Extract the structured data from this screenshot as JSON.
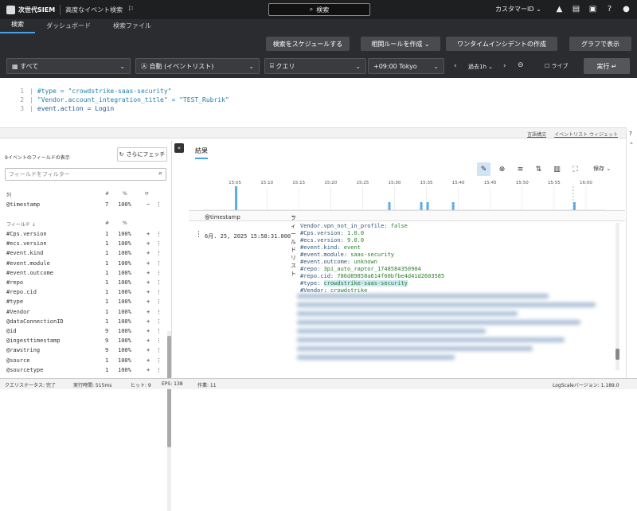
{
  "app": {
    "name": "次世代SIEM",
    "page_title": "高度なイベント検索"
  },
  "topbar": {
    "search_label": "検索",
    "customer_label": "カスタマーID"
  },
  "tabs": [
    {
      "label": "検索",
      "active": true
    },
    {
      "label": "ダッシュボード"
    },
    {
      "label": "検索ファイル"
    }
  ],
  "actions": {
    "schedule": "検索をスケジュールする",
    "related_rules": "相関ルールを作成",
    "onetime_incident": "ワンタイムインシデントの作成",
    "graph": "グラフで表示"
  },
  "query_bar": {
    "repo": "すべて",
    "mode": "自動 (イベントリスト)",
    "query": "クエリ",
    "timezone": "+09:00 Tokyo",
    "range": "過去1h",
    "live": "ライブ",
    "run": "実行"
  },
  "editor": {
    "lines": [
      {
        "num": "1",
        "op": "",
        "text": "#type = \"crowdstrike-saas-security\""
      },
      {
        "num": "2",
        "op": "| ",
        "text": "\"Vendor.account_integration_title\" = \"TEST_Rubrik\""
      },
      {
        "num": "3",
        "op": "| ",
        "text": "event.action = Login"
      }
    ]
  },
  "divider": {
    "syntax_link": "言語構文",
    "widget_link": "イベントリスト ウィジェット"
  },
  "fields_panel": {
    "title": "9イベントのフィールドの表示",
    "fetch_button": "さらにフェッチ",
    "filter_placeholder": "フィールドをフィルター",
    "column_header": {
      "name": "列",
      "count": "#",
      "pct": "%"
    },
    "columns": [
      {
        "name": "@timestamp",
        "count": "7",
        "pct": "100%"
      }
    ],
    "fields_header": {
      "name": "フィールド ↓",
      "count": "#",
      "pct": "%"
    },
    "fields": [
      {
        "name": "#Cps.version",
        "count": "1",
        "pct": "100%"
      },
      {
        "name": "#ecs.version",
        "count": "1",
        "pct": "100%"
      },
      {
        "name": "#event.kind",
        "count": "1",
        "pct": "100%"
      },
      {
        "name": "#event.module",
        "count": "1",
        "pct": "100%"
      },
      {
        "name": "#event.outcome",
        "count": "1",
        "pct": "100%"
      },
      {
        "name": "#repo",
        "count": "1",
        "pct": "100%"
      },
      {
        "name": "#repo.cid",
        "count": "1",
        "pct": "100%"
      },
      {
        "name": "#type",
        "count": "1",
        "pct": "100%"
      },
      {
        "name": "#Vendor",
        "count": "1",
        "pct": "100%"
      },
      {
        "name": "@dataConnectionID",
        "count": "1",
        "pct": "100%"
      },
      {
        "name": "@id",
        "count": "9",
        "pct": "100%"
      },
      {
        "name": "@ingesttimestamp",
        "count": "9",
        "pct": "100%"
      },
      {
        "name": "@rawstring",
        "count": "9",
        "pct": "100%"
      },
      {
        "name": "@source",
        "count": "1",
        "pct": "100%"
      },
      {
        "name": "@sourcetype",
        "count": "1",
        "pct": "100%"
      }
    ]
  },
  "results": {
    "tab": "結果",
    "hold": "保存",
    "col_timestamp": "@timestamp",
    "col_fields": "フィールドリスト",
    "timestamp": "6月. 25, 2025 15:58:31.000",
    "lines": [
      {
        "k": "Vendor.vpn_not_in_profile: ",
        "v": "false"
      },
      {
        "k": "#Cps.version: ",
        "v": "1.0.0"
      },
      {
        "k": "#ecs.version: ",
        "v": "9.0.0"
      },
      {
        "k": "#event.kind: ",
        "v": "event"
      },
      {
        "k": "#event.module: ",
        "v": "saas-security"
      },
      {
        "k": "#event.outcome: ",
        "v": "unknown"
      },
      {
        "k": "#repo: ",
        "v": "3pi_auto_raptor_1748584350904"
      },
      {
        "k": "#repo.cid: ",
        "v": "786d89858a614f60bfbe4d41d2603585"
      },
      {
        "k": "#type: ",
        "v": "crowdstrike-saas-security",
        "hl": true
      },
      {
        "k": "#Vendor: ",
        "v": "crowdstrike"
      }
    ]
  },
  "chart_data": {
    "type": "bar",
    "x_ticks": [
      "15:05",
      "15:10",
      "15:15",
      "15:20",
      "15:25",
      "15:30",
      "15:35",
      "15:40",
      "15:45",
      "15:50",
      "15:55",
      "16:00"
    ],
    "y_max_label": "3",
    "bars": [
      {
        "t": "15:05",
        "value": 3
      },
      {
        "t": "15:29",
        "value": 1
      },
      {
        "t": "15:34",
        "value": 1
      },
      {
        "t": "15:35",
        "value": 1
      },
      {
        "t": "15:39",
        "value": 1
      },
      {
        "t": "15:58",
        "value": 1
      }
    ],
    "color": "#5aaee0"
  },
  "status": {
    "query_status": "クエリステータス: 完了",
    "exec_time": "実行時間: 515ms",
    "hits": "ヒット: 9",
    "eps": "EPS: 138",
    "work": "作業: 11",
    "version": "LogScaleバージョン: 1.189.0"
  }
}
